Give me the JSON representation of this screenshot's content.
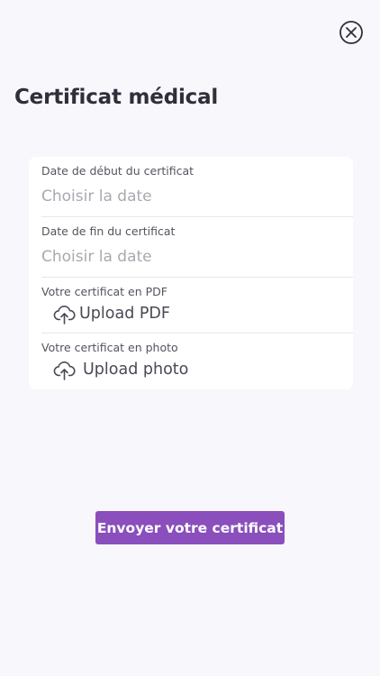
{
  "header": {
    "title": "Certificat médical",
    "close_icon": "close-circle-icon"
  },
  "form": {
    "start_date": {
      "label": "Date de début du certificat",
      "placeholder": "Choisir la date"
    },
    "end_date": {
      "label": "Date de fin du certificat",
      "placeholder": "Choisir la date"
    },
    "pdf_upload": {
      "label": "Votre certificat en PDF",
      "button_label": "Upload PDF",
      "icon": "cloud-upload-icon"
    },
    "photo_upload": {
      "label": "Votre certificat en photo",
      "button_label": "Upload photo",
      "icon": "cloud-upload-icon"
    }
  },
  "submit": {
    "label": "Envoyer votre certificat"
  },
  "colors": {
    "background": "#f8f7fb",
    "card": "#ffffff",
    "accent": "#8a4ebd",
    "placeholder": "#a9a8b0"
  }
}
